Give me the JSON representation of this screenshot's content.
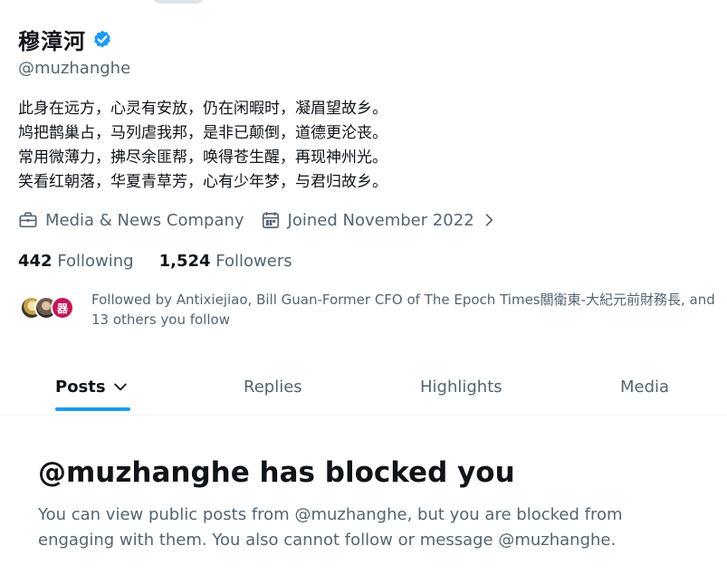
{
  "profile": {
    "display_name": "穆漳河",
    "handle": "@muzhanghe",
    "bio": "此身在远方，心灵有安放，仍在闲暇时，凝眉望故乡。\n鸠把鹊巢占，马列虐我邦，是非已颠倒，道德更沦丧。\n常用微薄力，拂尽余匪帮，唤得苍生醒，再现神州光。\n笑看红朝落，华夏青草芳，心有少年梦，与君归故乡。",
    "category": "Media & News Company",
    "joined": "Joined November 2022",
    "verified_icon": "verified-badge-icon",
    "accent_color": "#1d9bf0"
  },
  "stats": {
    "following_count": "442",
    "following_label": "Following",
    "followers_count": "1,524",
    "followers_label": "Followers"
  },
  "followed_by": {
    "text": "Followed by Antixiejiao, Bill Guan-Former CFO of The Epoch Times關衛東-大紀元前財務長, and 13 others you follow",
    "badge_glyph": "器"
  },
  "tabs": [
    {
      "label": "Posts",
      "active": true
    },
    {
      "label": "Replies",
      "active": false
    },
    {
      "label": "Highlights",
      "active": false
    },
    {
      "label": "Media",
      "active": false
    }
  ],
  "blocked": {
    "title": "@muzhanghe has blocked you",
    "description": "You can view public posts from @muzhanghe, but you are blocked from engaging with them. You also cannot follow or message @muzhanghe."
  }
}
